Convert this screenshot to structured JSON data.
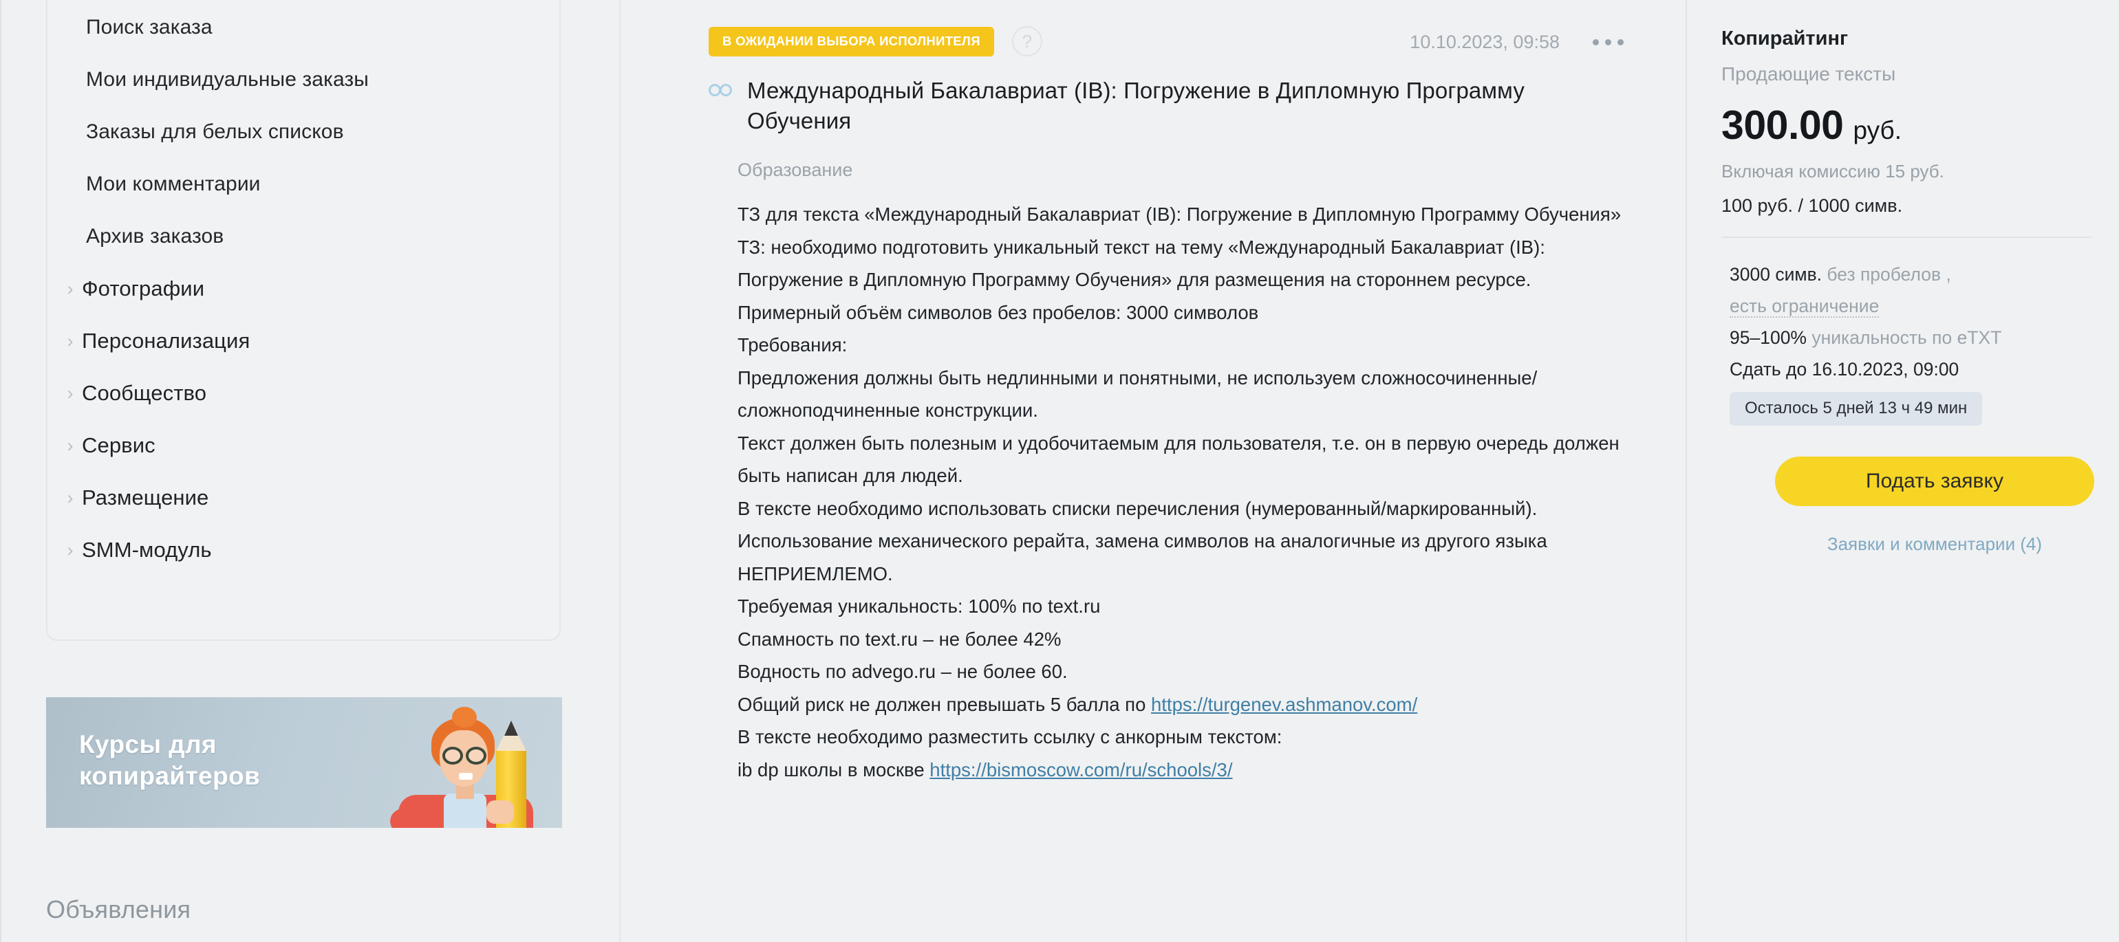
{
  "sidebar": {
    "nav_items": [
      {
        "label": "Поиск заказа",
        "type": "sub",
        "chevron": ""
      },
      {
        "label": "Мои индивидуальные заказы",
        "type": "sub",
        "chevron": ""
      },
      {
        "label": "Заказы для белых списков",
        "type": "sub",
        "chevron": ""
      },
      {
        "label": "Мои комментарии",
        "type": "sub",
        "chevron": ""
      },
      {
        "label": "Архив заказов",
        "type": "sub",
        "chevron": ""
      },
      {
        "label": "Фотографии",
        "type": "group",
        "chevron": "›"
      },
      {
        "label": "Персонализация",
        "type": "group",
        "chevron": "›"
      },
      {
        "label": "Сообщество",
        "type": "group",
        "chevron": "›"
      },
      {
        "label": "Сервис",
        "type": "group",
        "chevron": "›"
      },
      {
        "label": "Размещение",
        "type": "group",
        "chevron": "›"
      },
      {
        "label": "SMM-модуль",
        "type": "group",
        "chevron": "›"
      }
    ],
    "ad_banner": {
      "line1": "Курсы для",
      "line2": "копирайтеров"
    },
    "ads_heading": "Объявления"
  },
  "order": {
    "status_badge": "В ОЖИДАНИИ ВЫБОРА ИСПОЛНИТЕЛЯ",
    "help_icon": "?",
    "timestamp": "10.10.2023, 09:58",
    "title": "Международный Бакалавриат (IB): Погружение в Дипломную Программу Обучения",
    "category": "Образование",
    "body_lines": [
      {
        "text": "ТЗ для текста «Международный Бакалавриат (IB): Погружение в Дипломную Программу Обучения»"
      },
      {
        "text": "ТЗ: необходимо подготовить уникальный текст на тему «Международный Бакалавриат (IB): Погружение в Дипломную Программу Обучения» для размещения на стороннем ресурсе."
      },
      {
        "text": "Примерный объём символов без пробелов: 3000 символов"
      },
      {
        "text": "Требования:"
      },
      {
        "text": "Предложения должны быть недлинными и понятными, не используем сложносочиненные/сложноподчиненные конструкции."
      },
      {
        "text": "Текст должен быть полезным и удобочитаемым для пользователя, т.е. он в первую очередь должен быть написан для людей."
      },
      {
        "text": "В тексте необходимо использовать списки перечисления (нумерованный/маркированный)."
      },
      {
        "text": "Использование механического рерайта, замена символов на аналогичные из другого языка НЕПРИЕМЛЕМО."
      },
      {
        "text": "Требуемая уникальность: 100% по text.ru"
      },
      {
        "text": "Спамность по text.ru – не более 42%"
      },
      {
        "text": "Водность по advego.ru – не более 60."
      },
      {
        "text": "Общий риск не должен превышать 5 балла по ",
        "link": "https://turgenev.ashmanov.com/"
      },
      {
        "text": "В тексте необходимо разместить ссылку с анкорным текстом:"
      },
      {
        "text": "ib dp школы в москве ",
        "link": "https://bismoscow.com/ru/schools/3/"
      }
    ]
  },
  "panel": {
    "service_name": "Копирайтинг",
    "service_subtype": "Продающие тексты",
    "price_amount": "300.00",
    "price_currency": "руб.",
    "commission": "Включая комиссию 15 руб.",
    "rate": "100 руб. / 1000 симв.",
    "spec_volume_value": "3000 симв.",
    "spec_volume_note": "без пробелов ,",
    "spec_limit": "есть ограничение",
    "spec_unique_value": "95–100%",
    "spec_unique_note": "уникальность по eTXT",
    "spec_deadline": "Сдать до 16.10.2023, 09:00",
    "countdown": "Осталось 5 дней 13 ч 49 мин",
    "apply_button": "Подать заявку",
    "bids_link": "Заявки и комментарии (4)"
  },
  "colors": {
    "accent_yellow": "#f7d524",
    "badge_yellow": "#f5c51c",
    "link_blue": "#3f7fa6",
    "page_bg": "#f0f1f2"
  }
}
